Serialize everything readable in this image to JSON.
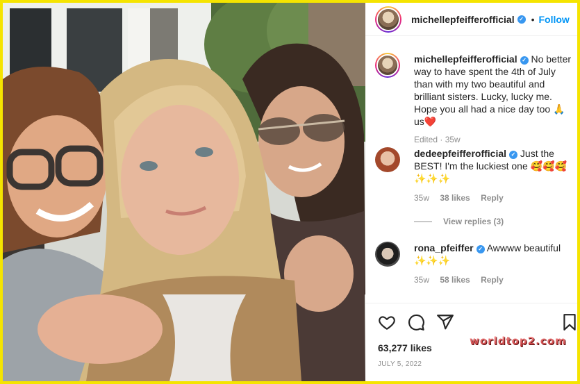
{
  "post": {
    "username": "michellepfeifferofficial",
    "header_separator": "•",
    "follow_label": "Follow",
    "more_icon": "more-horizontal-icon"
  },
  "caption": {
    "username": "michellepfeifferofficial",
    "text": "No better way to have spent the 4th of July than with my two beautiful and brilliant sisters. Lucky, lucky me. Hope you all had a nice day too 🙏us❤️",
    "meta": "Edited · 35w"
  },
  "comments": [
    {
      "username": "dedeepfeifferofficial",
      "text": "Just the BEST! I'm the luckiest one 🥰🥰🥰 ✨✨✨",
      "time": "35w",
      "likes": "38 likes",
      "reply_label": "Reply"
    },
    {
      "username": "rona_pfeiffer",
      "text": "Awwww beautiful ✨✨✨",
      "time": "35w",
      "likes": "58 likes",
      "reply_label": "Reply"
    }
  ],
  "view_replies": "View replies (3)",
  "actions": {
    "like_icon": "heart-icon",
    "comment_icon": "comment-icon",
    "share_icon": "share-icon",
    "save_icon": "bookmark-icon"
  },
  "likes_count": "63,277 likes",
  "post_date": "JULY 5, 2022",
  "watermark": "worldtop2.com",
  "colors": {
    "frame": "#f5e400",
    "link_blue": "#0095f6",
    "verified_blue": "#3897f0",
    "text": "#262626",
    "muted": "#8e8e8e",
    "heart_red": "#ed4956"
  }
}
